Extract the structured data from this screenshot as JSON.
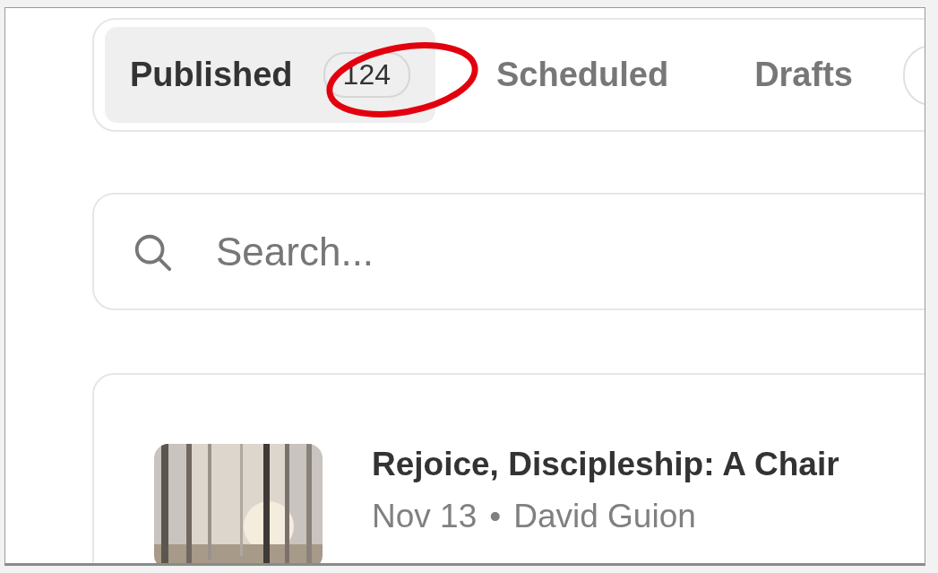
{
  "tabs": [
    {
      "label": "Published",
      "selected": true,
      "count": "124",
      "highlighted": true
    },
    {
      "label": "Scheduled",
      "selected": false
    },
    {
      "label": "Drafts",
      "selected": false
    }
  ],
  "search": {
    "placeholder": "Search..."
  },
  "posts": [
    {
      "kind": "picture",
      "title": "Rejoice, Discipleship: A Chair",
      "date": "Nov 13",
      "separator": "•",
      "author": "David Guion"
    }
  ]
}
